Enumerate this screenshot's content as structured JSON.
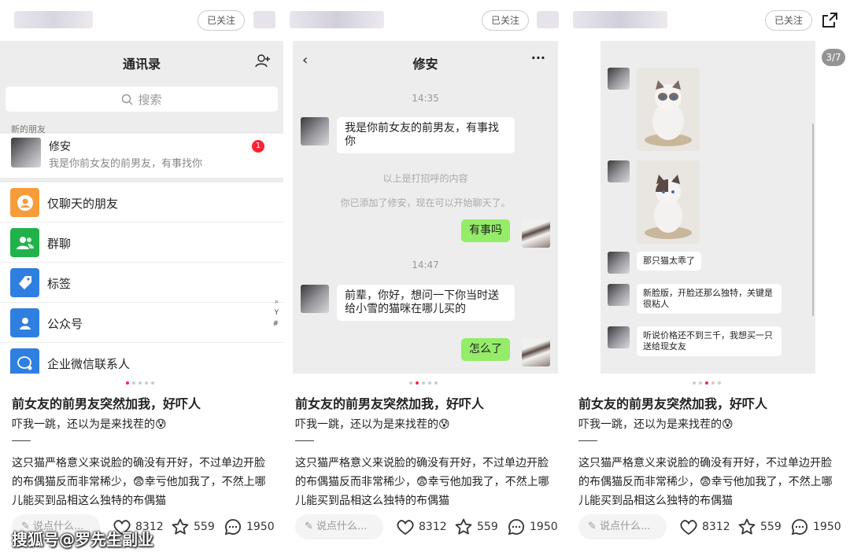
{
  "post": {
    "follow_label": "已关注",
    "title": "前女友的前男友突然加我，好吓人",
    "subtitle": "吓我一跳，还以为是来找茬的",
    "body": "这只猫严格意义来说脸的确没有开好，不过单边开脸的布偶猫反而非常稀少，😨幸亏他加我了，不然上哪儿能买到品相这么独特的布偶猫",
    "comment_placeholder": "说点什么...",
    "likes": "8312",
    "favorites": "559",
    "comments": "1950",
    "image_index": "3/7",
    "watermark": "搜狐号@罗先生副业"
  },
  "contacts": {
    "title": "通讯录",
    "search_placeholder": "搜索",
    "new_friends_section": "新的朋友",
    "new_friend": {
      "name": "修安",
      "message": "我是你前女友的前男友，有事找你",
      "badge": "1"
    },
    "items": [
      {
        "label": "仅聊天的朋友",
        "icon": "chat-only-friend-icon",
        "color": "#f79c3b"
      },
      {
        "label": "群聊",
        "icon": "group-chat-icon",
        "color": "#21b24b"
      },
      {
        "label": "标签",
        "icon": "tag-icon",
        "color": "#2f7fe0"
      },
      {
        "label": "公众号",
        "icon": "official-account-icon",
        "color": "#2f7fe0"
      },
      {
        "label": "企业微信联系人",
        "icon": "wecom-contact-icon",
        "color": "#2f7fe0"
      }
    ],
    "index": [
      "Y",
      "#"
    ]
  },
  "chat": {
    "title": "修安",
    "time1": "14:35",
    "msg1": "我是你前女友的前男友，有事找你",
    "sys1": "以上是打招呼的内容",
    "sys2": "你已添加了修安，现在可以开始聊天了。",
    "reply1": "有事吗",
    "time2": "14:47",
    "msg2": "前辈，你好，想问一下你当时送给小雪的猫咪在哪儿买的",
    "reply2": "怎么了"
  },
  "chat2": {
    "msg1": "那只猫太乖了",
    "msg2": "新脸版，开脸还那么独特，关键是很粘人",
    "msg3": "听说价格还不到三千，我想买一只送给现女友"
  }
}
